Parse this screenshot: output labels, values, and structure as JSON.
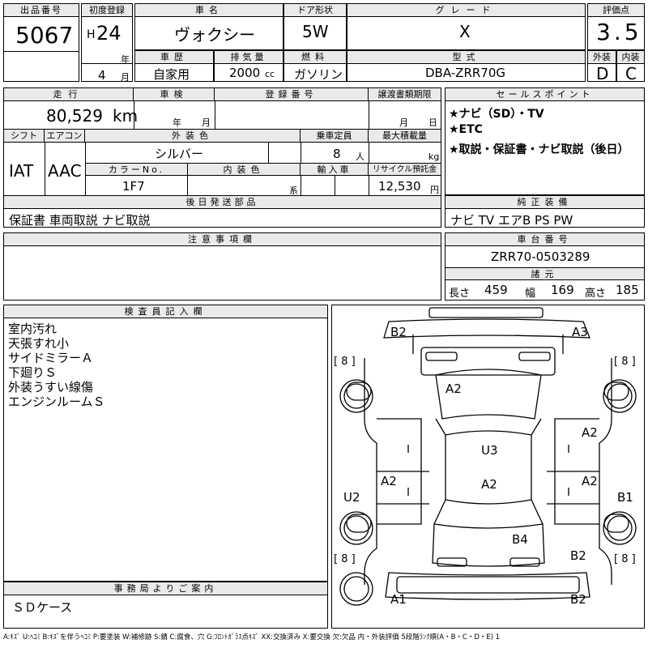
{
  "lot": {
    "label": "出品番号",
    "value": "5067"
  },
  "reg": {
    "label": "初度登録",
    "era": "H",
    "year": "24",
    "year_unit": "年",
    "month": "4",
    "month_unit": "月"
  },
  "car": {
    "label": "車名",
    "value": "ヴォクシー"
  },
  "door": {
    "label": "ドア形状",
    "value": "5W"
  },
  "grade": {
    "label": "グレード",
    "value": "X"
  },
  "score": {
    "label": "評価点",
    "value": "3.5"
  },
  "history": {
    "label": "車歴",
    "value": "自家用"
  },
  "displacement": {
    "label": "排気量",
    "value": "2000",
    "unit": "cc"
  },
  "fuel": {
    "label": "燃料",
    "value": "ガソリン"
  },
  "model": {
    "label": "型式",
    "value": "DBA-ZRR70G"
  },
  "exterior_grade": {
    "label": "外装",
    "value": "D"
  },
  "interior_grade": {
    "label": "内装",
    "value": "C"
  },
  "mileage": {
    "label": "走行",
    "value": "80,529",
    "unit": "km"
  },
  "inspection": {
    "label": "車検",
    "year_unit": "年",
    "month_unit": "月"
  },
  "plate": {
    "label": "登録番号"
  },
  "transfer": {
    "label": "譲渡書類期限",
    "month_unit": "月",
    "day_unit": "日"
  },
  "shift": {
    "label": "シフト",
    "value": "IAT"
  },
  "aircon": {
    "label": "エアコン",
    "value": "AAC"
  },
  "color": {
    "label": "外装色",
    "value": "シルバー"
  },
  "capacity": {
    "label": "乗車定員",
    "value": "8",
    "unit": "人"
  },
  "load": {
    "label": "最大積載量",
    "unit": "kg"
  },
  "color_no": {
    "label": "カラーNo.",
    "value": "1F7"
  },
  "int_color": {
    "label": "内装色",
    "unit": "系"
  },
  "import": {
    "label": "輸入車"
  },
  "recycle": {
    "label": "リサイクル預託金",
    "value": "12,530",
    "unit": "円"
  },
  "sales": {
    "label": "セールスポイント",
    "items": [
      "★ナビ（SD）・TV",
      "★ETC",
      "★取説・保証書・ナビ取説（後日）"
    ]
  },
  "later": {
    "label": "後日発送部品",
    "value": "保証書 車両取説 ナビ取説"
  },
  "equip": {
    "label": "純正装備",
    "value": "ナビ TV エアB PS PW"
  },
  "notes": {
    "label": "注意事項欄"
  },
  "chassis": {
    "label": "車台番号",
    "value": "ZRR70-0503289"
  },
  "specs": {
    "label": "諸元",
    "length_label": "長さ",
    "length": "459",
    "width_label": "幅",
    "width": "169",
    "height_label": "高さ",
    "height": "185"
  },
  "inspector": {
    "label": "検査員記入欄",
    "lines": [
      "室内汚れ",
      "天張すれ小",
      "サイドミラーＡ",
      "下廻りＳ",
      "外装うすい線傷",
      "エンジンルームＳ"
    ]
  },
  "office": {
    "label": "事務局よりご案内",
    "value": "ＳＤケース"
  },
  "legend": "A:ｷｽﾞ U:ﾍｺﾐ B:ｷｽﾞを伴うﾍｺﾐ P:要塗装 W:補修跡 S:錆 C:腐食、穴 G:ﾌﾛﾝﾄｶﾞﾗｽ点ｷｽﾞ XX:交換済み X:要交換 欠:欠品 内・外装評価 5段階ﾗﾝｸ順(A・B・C・D・E) 1",
  "tire_label": "[ 8 ]",
  "damage": {
    "b2_top": "B2",
    "a3": "A3",
    "a2_hood": "A2",
    "a2_rf": "A2",
    "u3": "U3",
    "a2_lm": "A2",
    "a2_cm": "A2",
    "a2_rm": "A2",
    "u2": "U2",
    "b1": "B1",
    "b4": "B4",
    "b2_rr": "B2",
    "a1": "A1",
    "b2_bottom": "B2"
  }
}
